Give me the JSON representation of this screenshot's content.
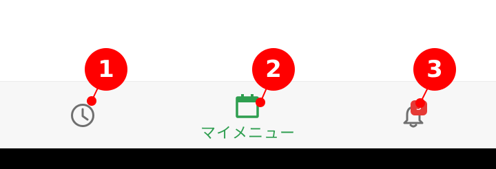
{
  "bottom_nav": {
    "items": [
      {
        "id": "history",
        "icon": "clock-icon"
      },
      {
        "id": "my_menu",
        "icon": "calendar-icon",
        "label": "マイメニュー"
      },
      {
        "id": "notifications",
        "icon": "bell-icon",
        "badge": "5"
      }
    ],
    "colors": {
      "active": "#2e9e4f",
      "inactive": "#6f6f6f",
      "badge": "#e53935",
      "background": "#f7f7f7"
    }
  },
  "callouts": {
    "items": [
      "1",
      "2",
      "3"
    ],
    "color": "#ff0000"
  }
}
